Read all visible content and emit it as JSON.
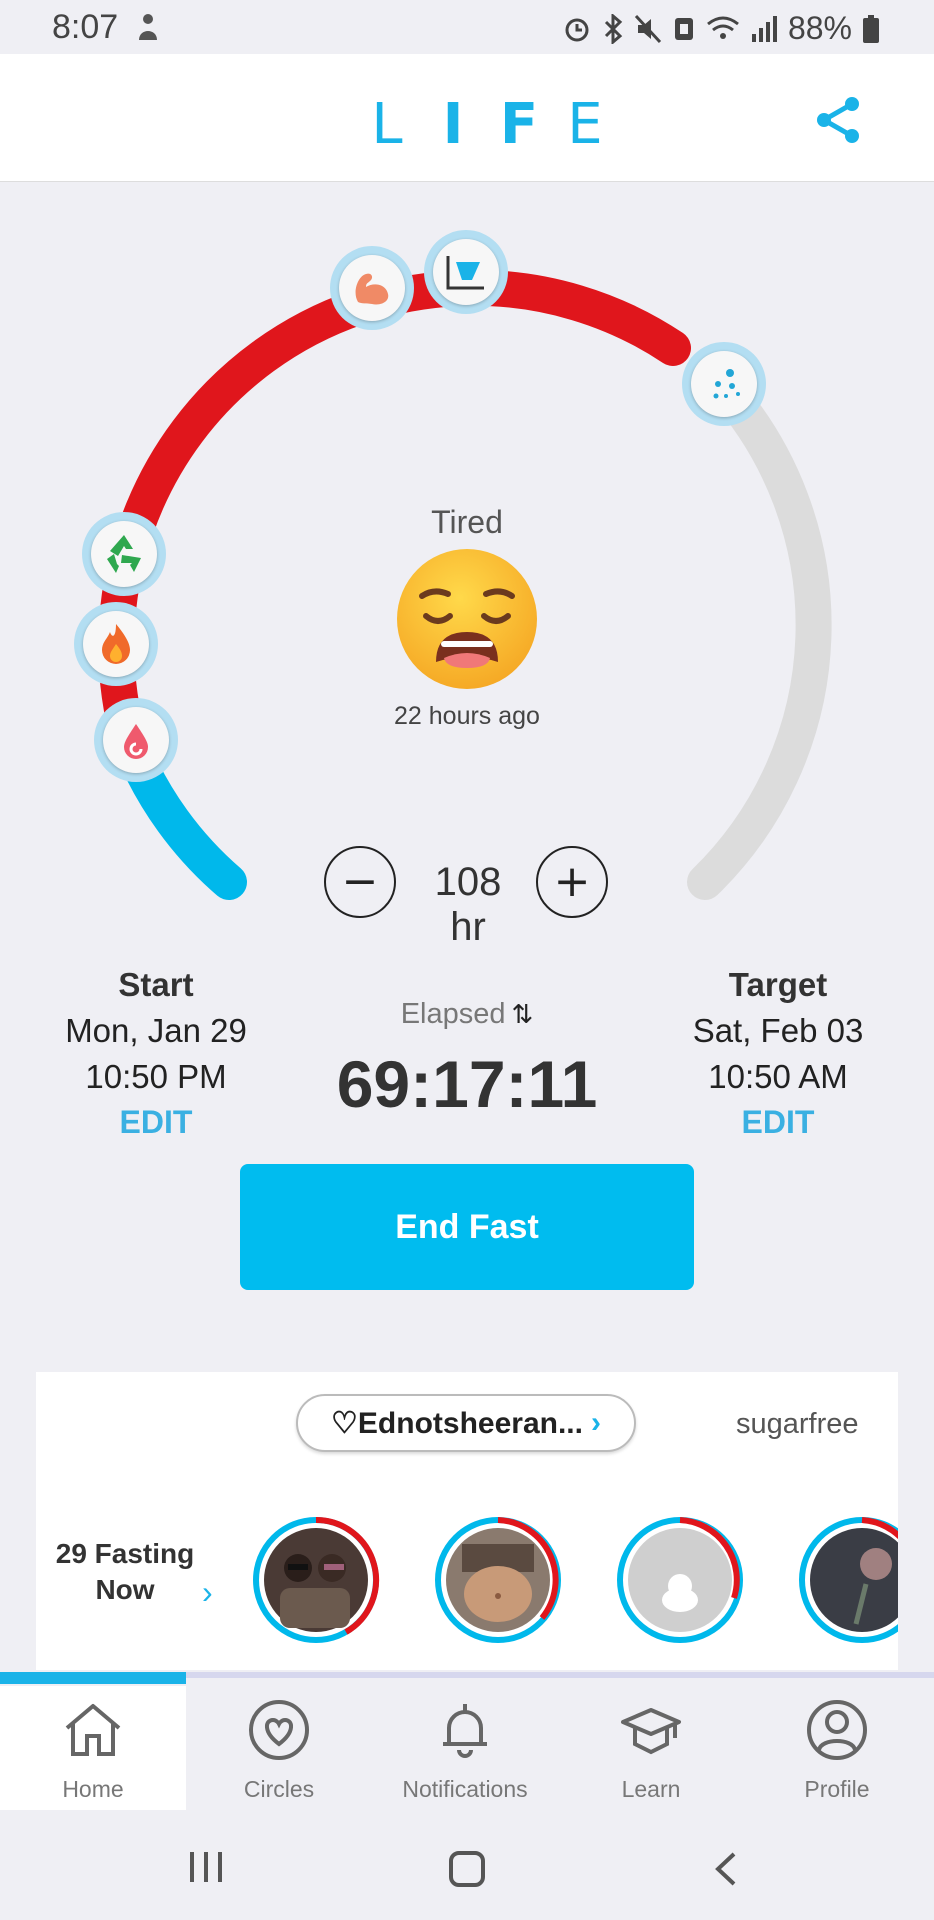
{
  "status_bar": {
    "time": "8:07",
    "battery_pct": "88%",
    "icons": [
      "person-icon",
      "alarm-icon",
      "bluetooth-icon",
      "mute-icon",
      "nfc-icon",
      "wifi-icon",
      "signal-icon",
      "battery-icon"
    ]
  },
  "header": {
    "logo_letters": [
      "L",
      "I",
      "F",
      "E"
    ],
    "share_icon": "share-icon",
    "accent": "#1ab3e8"
  },
  "fast_ring": {
    "colors": {
      "elapsed_early": "#00b8eb",
      "elapsed": "#e0161c",
      "remaining": "#dcdcdc"
    },
    "elapsed_fraction": 0.64,
    "milestones": [
      "blood-drop-icon",
      "flame-icon",
      "recycle-icon",
      "muscle-icon",
      "chart-icon",
      "stem-cell-icon"
    ]
  },
  "mood": {
    "label": "Tired",
    "time_ago": "22 hours ago"
  },
  "duration": {
    "minus_label": "−",
    "value": "108 hr",
    "plus_label": "+"
  },
  "start": {
    "title": "Start",
    "date": "Mon, Jan 29",
    "time": "10:50 PM",
    "edit": "EDIT"
  },
  "elapsed": {
    "label": "Elapsed",
    "swap_icon": "⇅",
    "value": "69:17:11"
  },
  "target": {
    "title": "Target",
    "date": "Sat, Feb 03",
    "time": "10:50 AM",
    "edit": "EDIT"
  },
  "end_button": "End Fast",
  "circles": {
    "pill_label": "♡Ednotsheeran...",
    "pill_chevron": "›",
    "other_circle": "sugarfree",
    "fasting_now": "29 Fasting Now",
    "fasting_chevron": "›"
  },
  "bottom_nav": {
    "active_index": 0,
    "items": [
      {
        "label": "Home",
        "icon": "home-icon"
      },
      {
        "label": "Circles",
        "icon": "heart-circle-icon"
      },
      {
        "label": "Notifications",
        "icon": "bell-icon"
      },
      {
        "label": "Learn",
        "icon": "graduation-cap-icon"
      },
      {
        "label": "Profile",
        "icon": "profile-icon"
      }
    ]
  },
  "system_nav": [
    "recent-apps-icon",
    "home-button-icon",
    "back-icon"
  ]
}
